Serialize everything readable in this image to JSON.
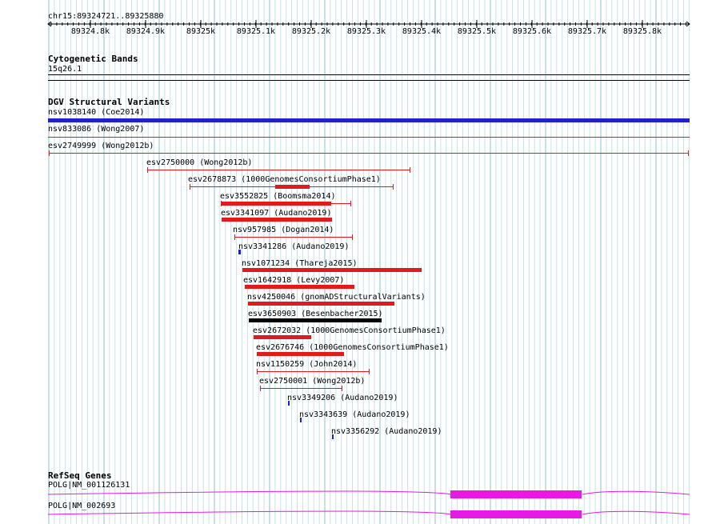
{
  "ruler": {
    "location": "chr15:89324721..89325880",
    "ticks": [
      "89324.8k",
      "89324.9k",
      "89325k",
      "89325.1k",
      "89325.2k",
      "89325.3k",
      "89325.4k",
      "89325.5k",
      "89325.6k",
      "89325.7k",
      "89325.8k"
    ]
  },
  "cytobands": {
    "title": "Cytogenetic Bands",
    "band": "15q26.1"
  },
  "dgv": {
    "title": "DGV Structural Variants",
    "variants": [
      {
        "label": "nsv1038140 (Coe2014)",
        "color": "#1f1fd6",
        "style": "thick"
      },
      {
        "label": "nsv833086 (Wong2007)",
        "color": "#e11b1b",
        "style": "thin"
      },
      {
        "label": "esv2749999 (Wong2012b)",
        "color": "#e11b1b",
        "style": "span"
      },
      {
        "label": "esv2750000 (Wong2012b)",
        "color": "#e11b1b",
        "style": "span"
      },
      {
        "label": "esv2678873 (1000GenomesConsortiumPhase1)",
        "color": "#e11b1b",
        "style": "span-block"
      },
      {
        "label": "esv3552825 (Boomsma2014)",
        "color": "#e11b1b",
        "style": "span-block"
      },
      {
        "label": "esv3341097 (Audano2019)",
        "color": "#e11b1b",
        "style": "block"
      },
      {
        "label": "nsv957985 (Dogan2014)",
        "color": "#e11b1b",
        "style": "span"
      },
      {
        "label": "nsv3341286 (Audano2019)",
        "color": "#1f1fd6",
        "style": "block"
      },
      {
        "label": "nsv1071234 (Thareja2015)",
        "color": "#e11b1b",
        "style": "block"
      },
      {
        "label": "esv1642918 (Levy2007)",
        "color": "#e11b1b",
        "style": "block"
      },
      {
        "label": "nsv4250046 (gnomADStructuralVariants)",
        "color": "#e11b1b",
        "style": "block"
      },
      {
        "label": "esv3650903 (Besenbacher2015)",
        "color": "#000000",
        "style": "block"
      },
      {
        "label": "esv2672032 (1000GenomesConsortiumPhase1)",
        "color": "#e11b1b",
        "style": "block"
      },
      {
        "label": "esv2676746 (1000GenomesConsortiumPhase1)",
        "color": "#e11b1b",
        "style": "block"
      },
      {
        "label": "nsv1150259 (John2014)",
        "color": "#e11b1b",
        "style": "span"
      },
      {
        "label": "esv2750001 (Wong2012b)",
        "color": "#e11b1b",
        "style": "span"
      },
      {
        "label": "nsv3349206 (Audano2019)",
        "color": "#1f1fd6",
        "style": "block"
      },
      {
        "label": "nsv3343639 (Audano2019)",
        "color": "#1f1fd6",
        "style": "block"
      },
      {
        "label": "nsv3356292 (Audano2019)",
        "color": "#1f1fd6",
        "style": "block"
      }
    ]
  },
  "refseq": {
    "title": "RefSeq Genes",
    "genes": [
      {
        "label": "POLG|NM_001126131",
        "color": "#e619e6"
      },
      {
        "label": "POLG|NM_002693",
        "color": "#e619e6"
      }
    ]
  }
}
